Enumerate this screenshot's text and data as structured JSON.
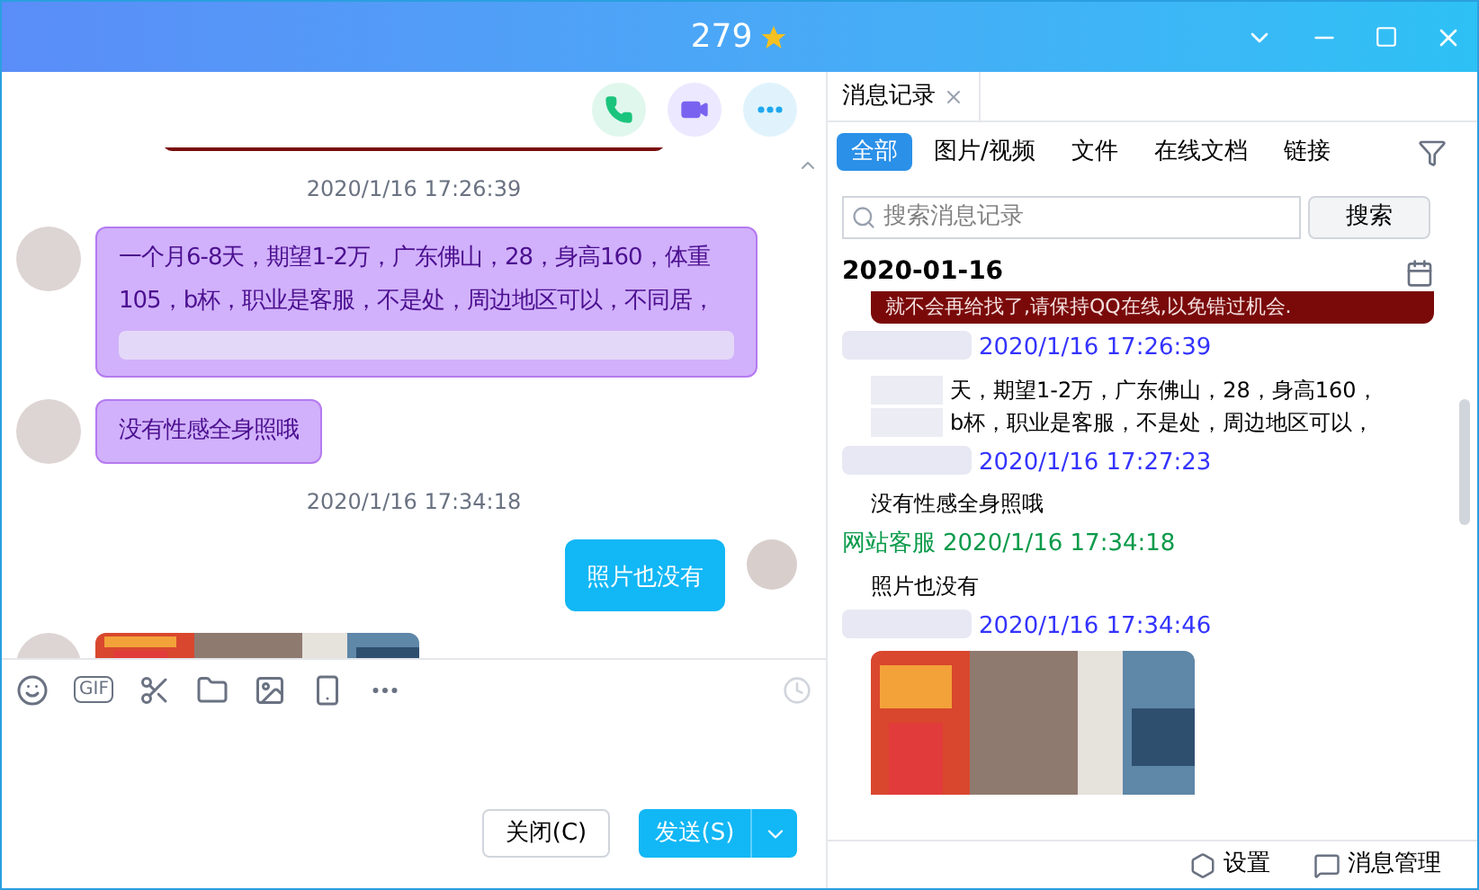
{
  "window": {
    "title": "279"
  },
  "chat": {
    "messages": [
      {
        "kind": "banner"
      },
      {
        "kind": "time",
        "text": "2020/1/16 17:26:39"
      },
      {
        "kind": "incoming",
        "text": "一个月6-8天，期望1-2万，广东佛山，28，身高160，体重105，b杯，职业是客服，不是处，周边地区可以，不同居，",
        "blurred": true
      },
      {
        "kind": "incoming",
        "text": "没有性感全身照哦",
        "blurred": false
      },
      {
        "kind": "time",
        "text": "2020/1/16 17:34:18"
      },
      {
        "kind": "outgoing",
        "text": "照片也没有"
      },
      {
        "kind": "incoming_picture"
      }
    ]
  },
  "toolbar": {
    "gif_label": "GIF"
  },
  "buttons": {
    "close": "关闭(C)",
    "send": "发送(S)"
  },
  "history": {
    "tab": "消息记录",
    "filters": [
      {
        "label": "全部",
        "selected": true
      },
      {
        "label": "图片/视频",
        "selected": false
      },
      {
        "label": "文件",
        "selected": false
      },
      {
        "label": "在线文档",
        "selected": false
      },
      {
        "label": "链接",
        "selected": false
      }
    ],
    "search": {
      "placeholder": "搜索消息记录",
      "button": "搜索"
    },
    "date": "2020-01-16",
    "banner": "就不会再给找了,请保持QQ在线,以免错过机会.",
    "entries": [
      {
        "kind": "text",
        "time": "2020/1/16 17:26:39",
        "color": "#3333ff",
        "lines": [
          "天，期望1-2万，广东佛山，28，身高160，",
          "b杯，职业是客服，不是处，周边地区可以，"
        ],
        "blurred": true
      },
      {
        "kind": "text",
        "time": "2020/1/16 17:27:23",
        "color": "#3333ff",
        "lines": [
          "没有性感全身照哦"
        ],
        "blurred": false
      },
      {
        "kind": "text",
        "sender": "网站客服",
        "time": "2020/1/16 17:34:18",
        "color": "#0a9a4a",
        "lines": [
          "照片也没有"
        ],
        "blurred": false
      },
      {
        "kind": "picture",
        "time": "2020/1/16 17:34:46",
        "color": "#3333ff"
      }
    ],
    "footer": {
      "settings": "设置",
      "manage": "消息管理"
    }
  }
}
